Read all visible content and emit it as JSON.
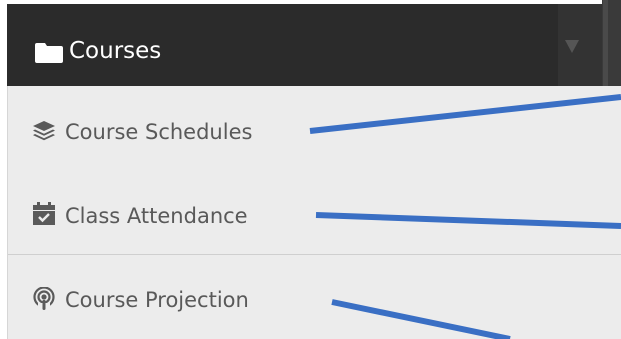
{
  "header": {
    "title": "Courses",
    "folder_icon": "folder-icon",
    "caret_icon": "caret-down-icon"
  },
  "menu": {
    "items": [
      {
        "label": "Course Schedules",
        "icon": "layers-icon"
      },
      {
        "label": "Class Attendance",
        "icon": "calendar-check-icon"
      },
      {
        "label": "Course Projection",
        "icon": "podcast-icon"
      }
    ]
  },
  "colors": {
    "header_bg": "#2b2b2b",
    "menu_bg": "#ececec",
    "text": "#595959",
    "annotation_line": "#3a6fc4"
  }
}
